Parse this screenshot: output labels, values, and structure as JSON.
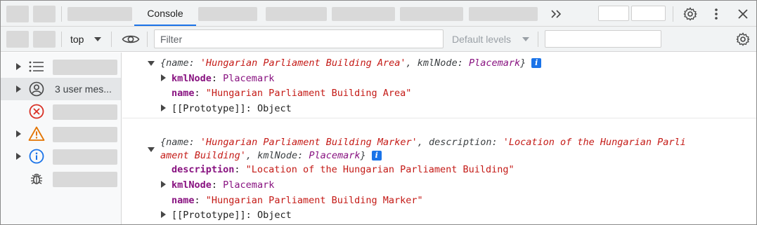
{
  "tabs": {
    "console_label": "Console",
    "more_icon": "chevron-double-right-icon"
  },
  "toolbar": {
    "context_value": "top",
    "filter_placeholder": "Filter",
    "levels_label": "Default levels"
  },
  "sidebar": {
    "items": [
      {
        "icon": "list-icon",
        "label": ""
      },
      {
        "icon": "user-circle-icon",
        "label": "3 user mes..."
      },
      {
        "icon": "error-circle-icon",
        "label": ""
      },
      {
        "icon": "warning-triangle-icon",
        "label": ""
      },
      {
        "icon": "info-circle-icon",
        "label": ""
      },
      {
        "icon": "bug-icon",
        "label": ""
      }
    ]
  },
  "console": {
    "entries": [
      {
        "summary": {
          "open": "{",
          "name_key": "name",
          "name_val": "'Hungarian Parliament Building Area'",
          "sep": ", ",
          "kml_key": "kmlNode",
          "kml_val": "Placemark",
          "close": "}"
        },
        "props": [
          {
            "key": "kmlNode",
            "value": "Placemark"
          },
          {
            "key": "name",
            "value": "\"Hungarian Parliament Building Area\""
          },
          {
            "key": "[[Prototype]]",
            "value": "Object"
          }
        ]
      },
      {
        "summary": {
          "line1_open": "{",
          "name_key": "name",
          "name_val": "'Hungarian Parliament Building Marker'",
          "desc_key": "description",
          "desc_val_part1": "'Location of the Hungarian Parli",
          "desc_val_part2": "ament Building'",
          "kml_key": "kmlNode",
          "kml_val": "Placemark",
          "close": "}"
        },
        "props": [
          {
            "key": "description",
            "value": "\"Location of the Hungarian Parliament Building\""
          },
          {
            "key": "kmlNode",
            "value": "Placemark"
          },
          {
            "key": "name",
            "value": "\"Hungarian Parliament Building Marker\""
          },
          {
            "key": "[[Prototype]]",
            "value": "Object"
          }
        ]
      }
    ]
  },
  "colors": {
    "accent": "#1a73e8",
    "string": "#c41a16",
    "property": "#881280",
    "error": "#d93025",
    "warning": "#e37400"
  }
}
